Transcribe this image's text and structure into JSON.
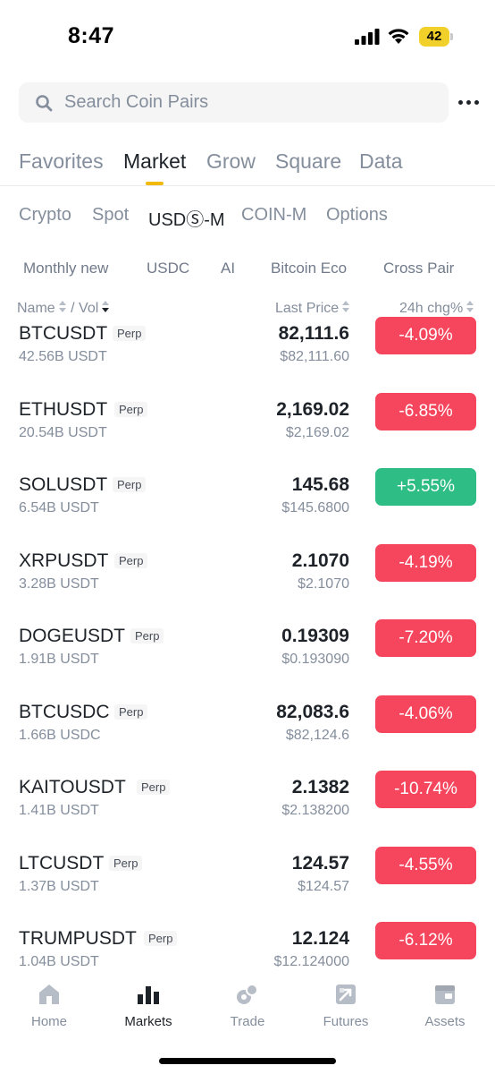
{
  "status_bar": {
    "time": "8:47",
    "battery": "42",
    "icons": [
      "signal-icon",
      "wifi-icon",
      "battery-icon"
    ]
  },
  "search": {
    "placeholder": "Search Coin Pairs",
    "icon": "search-icon",
    "more_icon": "more-icon"
  },
  "primary_tabs": [
    {
      "label": "Favorites"
    },
    {
      "label": "Market",
      "active": true
    },
    {
      "label": "Grow"
    },
    {
      "label": "Square"
    },
    {
      "label": "Data"
    }
  ],
  "secondary_tabs": [
    {
      "label": "Crypto"
    },
    {
      "label": "Spot"
    },
    {
      "label": "USDⓈ-M",
      "active": true
    },
    {
      "label": "COIN-M"
    },
    {
      "label": "Options"
    }
  ],
  "categories": [
    {
      "label": "Monthly new"
    },
    {
      "label": "USDC"
    },
    {
      "label": "AI"
    },
    {
      "label": "Bitcoin Eco"
    },
    {
      "label": "Cross Pair"
    }
  ],
  "columns": {
    "name": "Name",
    "separator": "/",
    "vol": "Vol",
    "last_price": "Last Price",
    "change": "24h chg%"
  },
  "rows": [
    {
      "pair": "BTCUSDT",
      "badge": "Perp",
      "vol": "42.56B USDT",
      "price": "82,111.6",
      "fiat": "$82,111.60",
      "change": "-4.09%",
      "direction": "down"
    },
    {
      "pair": "ETHUSDT",
      "badge": "Perp",
      "vol": "20.54B USDT",
      "price": "2,169.02",
      "fiat": "$2,169.02",
      "change": "-6.85%",
      "direction": "down"
    },
    {
      "pair": "SOLUSDT",
      "badge": "Perp",
      "vol": "6.54B USDT",
      "price": "145.68",
      "fiat": "$145.6800",
      "change": "+5.55%",
      "direction": "up"
    },
    {
      "pair": "XRPUSDT",
      "badge": "Perp",
      "vol": "3.28B USDT",
      "price": "2.1070",
      "fiat": "$2.1070",
      "change": "-4.19%",
      "direction": "down"
    },
    {
      "pair": "DOGEUSDT",
      "badge": "Perp",
      "vol": "1.91B USDT",
      "price": "0.19309",
      "fiat": "$0.193090",
      "change": "-7.20%",
      "direction": "down"
    },
    {
      "pair": "BTCUSDC",
      "badge": "Perp",
      "vol": "1.66B USDC",
      "price": "82,083.6",
      "fiat": "$82,124.6",
      "change": "-4.06%",
      "direction": "down"
    },
    {
      "pair": "KAITOUSDT",
      "badge": "Perp",
      "vol": "1.41B USDT",
      "price": "2.1382",
      "fiat": "$2.138200",
      "change": "-10.74%",
      "direction": "down"
    },
    {
      "pair": "LTCUSDT",
      "badge": "Perp",
      "vol": "1.37B USDT",
      "price": "124.57",
      "fiat": "$124.57",
      "change": "-4.55%",
      "direction": "down"
    },
    {
      "pair": "TRUMPUSDT",
      "badge": "Perp",
      "vol": "1.04B USDT",
      "price": "12.124",
      "fiat": "$12.124000",
      "change": "-6.12%",
      "direction": "down"
    }
  ],
  "bottom_nav": [
    {
      "label": "Home",
      "icon": "home-icon"
    },
    {
      "label": "Markets",
      "icon": "markets-icon",
      "active": true
    },
    {
      "label": "Trade",
      "icon": "trade-icon"
    },
    {
      "label": "Futures",
      "icon": "futures-icon"
    },
    {
      "label": "Assets",
      "icon": "assets-icon"
    }
  ],
  "colors": {
    "accent": "#f0b90b",
    "down": "#f6465d",
    "up": "#2ebd85",
    "text_primary": "#1e2329",
    "text_secondary": "#848e9c"
  }
}
